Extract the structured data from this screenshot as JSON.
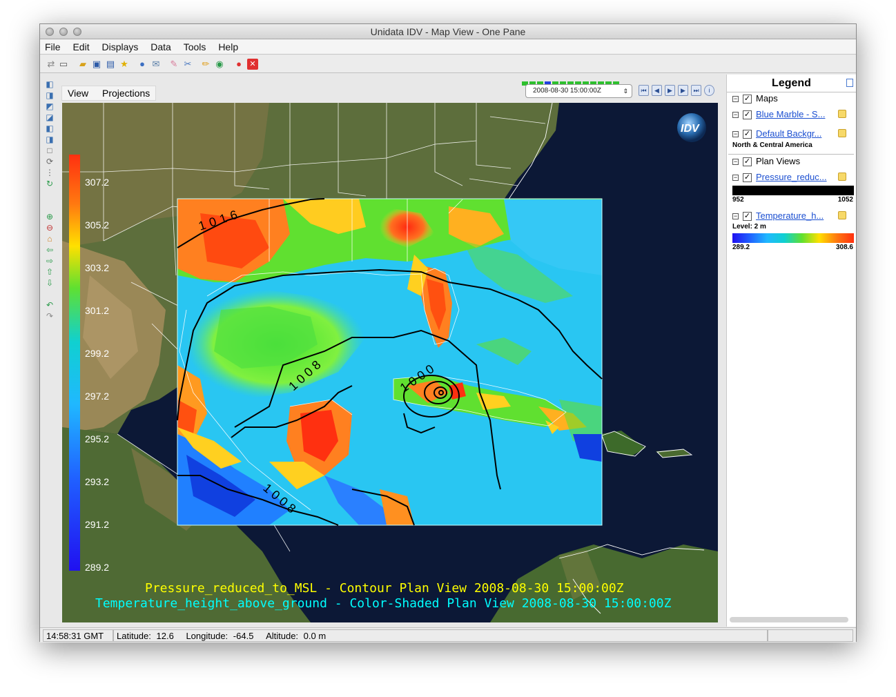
{
  "window": {
    "title": "Unidata IDV - Map View - One Pane"
  },
  "menu": [
    "File",
    "Edit",
    "Displays",
    "Data",
    "Tools",
    "Help"
  ],
  "view_menu": [
    "View",
    "Projections"
  ],
  "time": {
    "selected": "2008-08-30 15:00:00Z"
  },
  "colorbar": {
    "labels": [
      "307.2",
      "305.2",
      "303.2",
      "301.2",
      "299.2",
      "297.2",
      "295.2",
      "293.2",
      "291.2",
      "289.2"
    ]
  },
  "map": {
    "contour_labels": [
      "1016",
      "1008",
      "1000",
      "1008"
    ],
    "logo": "IDV",
    "caption_1": "Pressure_reduced_to_MSL - Contour Plan View 2008-08-30 15:00:00Z",
    "caption_2": "Temperature_height_above_ground - Color-Shaded Plan View 2008-08-30 15:00:00Z",
    "caption_1_color": "#ffff00",
    "caption_2_color": "#00ffff"
  },
  "legend": {
    "title": "Legend",
    "groups": [
      {
        "name": "Maps",
        "items": [
          {
            "label": "Blue Marble - S...",
            "sub": ""
          },
          {
            "label": "Default Backgr...",
            "sub": "North & Central America"
          }
        ]
      },
      {
        "name": "Plan Views",
        "items": [
          {
            "label": "Pressure_reduc...",
            "sub": "",
            "range_min": "952",
            "range_max": "1052"
          },
          {
            "label": "Temperature_h...",
            "sub": "Level: 2 m",
            "range_min": "289.2",
            "range_max": "308.6"
          }
        ]
      }
    ]
  },
  "status": {
    "clock": "14:58:31 GMT",
    "latitude_label": "Latitude:",
    "latitude": "12.6",
    "longitude_label": "Longitude:",
    "longitude": "-64.5",
    "altitude_label": "Altitude:",
    "altitude": "0.0 m"
  },
  "icons": [
    "new-window-icon",
    "open-file-icon",
    "save-icon",
    "favorite-star-icon",
    "help-icon",
    "mail-icon",
    "eraser-icon",
    "scissors-icon",
    "pencil-icon",
    "globe-icon",
    "stop-icon",
    "remove-icon"
  ]
}
